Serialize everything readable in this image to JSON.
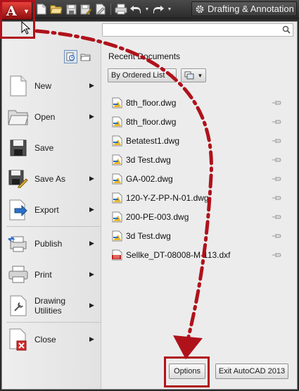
{
  "titlebar": {
    "app_letter": "A",
    "quick_access": [
      "new-icon",
      "open-icon",
      "save-icon",
      "save-as-icon",
      "plot-preview-icon",
      "print-icon",
      "undo-icon",
      "redo-icon"
    ],
    "workspace_label": "Drafting & Annotation"
  },
  "search": {
    "placeholder": ""
  },
  "menu": {
    "items": [
      {
        "label": "New",
        "icon": "new-file-icon",
        "submenu": true
      },
      {
        "label": "Open",
        "icon": "open-folder-icon",
        "submenu": true
      },
      {
        "label": "Save",
        "icon": "save-icon",
        "submenu": false
      },
      {
        "label": "Save As",
        "icon": "save-as-icon",
        "submenu": true
      },
      {
        "label": "Export",
        "icon": "export-icon",
        "submenu": true
      },
      {
        "label": "Publish",
        "icon": "publish-icon",
        "submenu": true
      },
      {
        "label": "Print",
        "icon": "print-icon",
        "submenu": true
      },
      {
        "label": "Drawing Utilities",
        "icon": "drawing-utilities-icon",
        "submenu": true
      },
      {
        "label": "Close",
        "icon": "close-drawing-icon",
        "submenu": true
      }
    ]
  },
  "recent": {
    "title": "Recent Documents",
    "order_label": "By Ordered List",
    "documents": [
      {
        "name": "8th_floor.dwg",
        "type": "dwg"
      },
      {
        "name": "8th_floor.dwg",
        "type": "dwg"
      },
      {
        "name": "Betatest1.dwg",
        "type": "dwg"
      },
      {
        "name": "3d Test.dwg",
        "type": "dwg"
      },
      {
        "name": "GA-002.dwg",
        "type": "dwg"
      },
      {
        "name": "120-Y-Z-PP-N-01.dwg",
        "type": "dwg"
      },
      {
        "name": "200-PE-003.dwg",
        "type": "dwg"
      },
      {
        "name": "3d Test.dwg",
        "type": "dwg"
      },
      {
        "name": "Sellke_DT-08008-M-113.dxf",
        "type": "dxf"
      }
    ]
  },
  "footer": {
    "options_label": "Options",
    "exit_label": "Exit AutoCAD 2013"
  },
  "colors": {
    "annotation_red": "#b0121b",
    "app_button_red": "#c4231f",
    "panel_bg": "#e9e9e9",
    "titlebar_bg": "#3a3a3a"
  }
}
